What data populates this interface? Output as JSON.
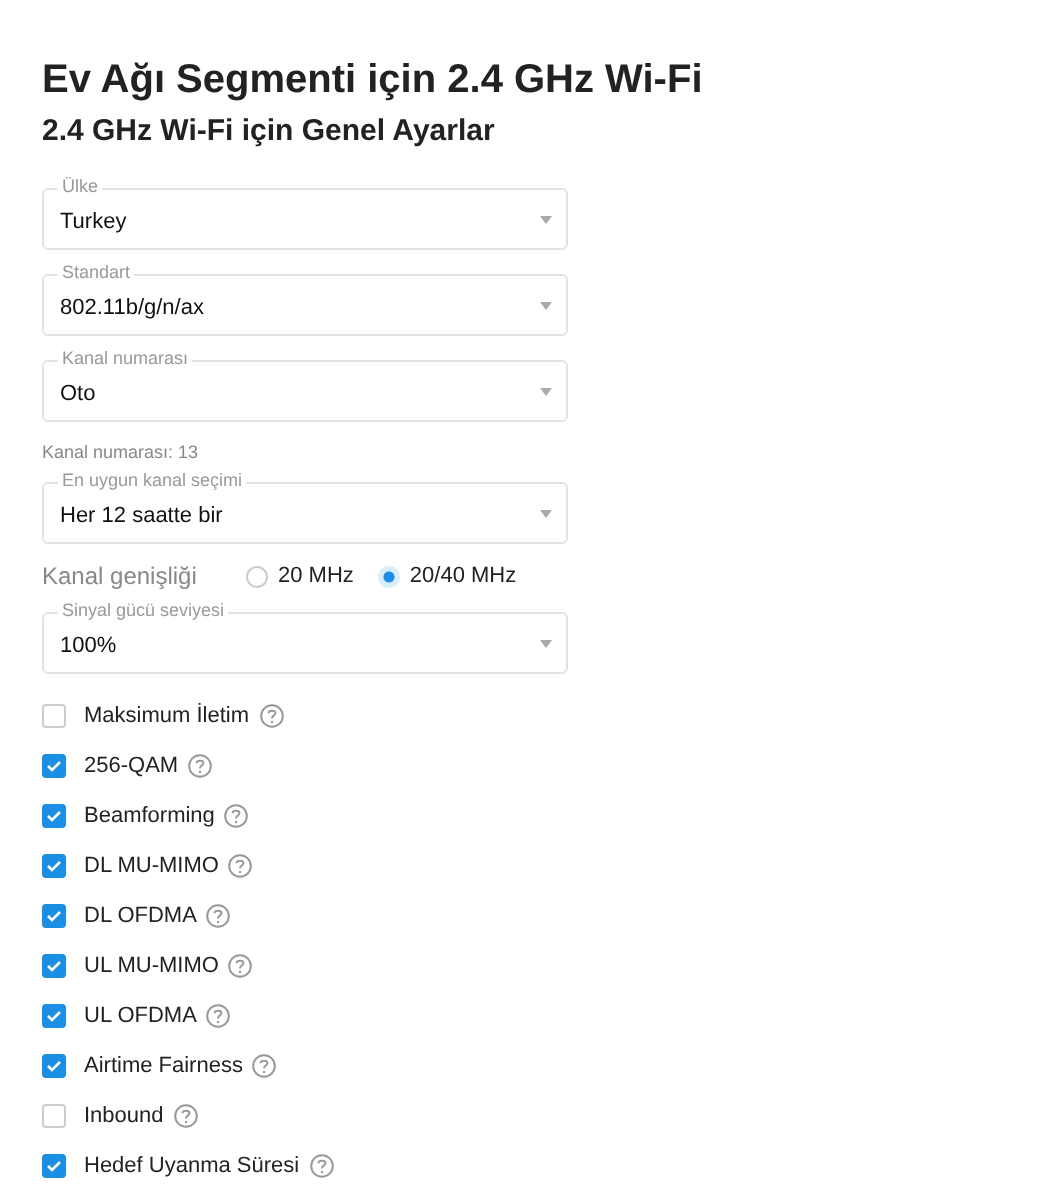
{
  "title": "Ev Ağı Segmenti için 2.4 GHz Wi-Fi",
  "subtitle": "2.4 GHz Wi-Fi için Genel Ayarlar",
  "fields": [
    {
      "kind": "select",
      "label": "Ülke",
      "value": "Turkey"
    },
    {
      "kind": "select",
      "label": "Standart",
      "value": "802.11b/g/n/ax"
    },
    {
      "kind": "select",
      "label": "Kanal numarası",
      "value": "Oto"
    },
    {
      "kind": "note",
      "text": "Kanal numarası: 13"
    },
    {
      "kind": "select",
      "label": "En uygun kanal seçimi",
      "value": "Her 12 saatte bir"
    },
    {
      "kind": "radio",
      "label": "Kanal genişliği",
      "options": [
        {
          "label": "20 MHz",
          "selected": false
        },
        {
          "label": "20/40 MHz",
          "selected": true
        }
      ]
    },
    {
      "kind": "select",
      "label": "Sinyal gücü seviyesi",
      "value": "100%"
    }
  ],
  "checkboxes": [
    {
      "label": "Maksimum İletim",
      "checked": false
    },
    {
      "label": "256-QAM",
      "checked": true
    },
    {
      "label": "Beamforming",
      "checked": true
    },
    {
      "label": "DL MU-MIMO",
      "checked": true
    },
    {
      "label": "DL OFDMA",
      "checked": true
    },
    {
      "label": "UL MU-MIMO",
      "checked": true
    },
    {
      "label": "UL OFDMA",
      "checked": true
    },
    {
      "label": "Airtime Fairness",
      "checked": true
    },
    {
      "label": "Inbound",
      "checked": false
    },
    {
      "label": "Hedef Uyanma Süresi",
      "checked": true
    }
  ]
}
